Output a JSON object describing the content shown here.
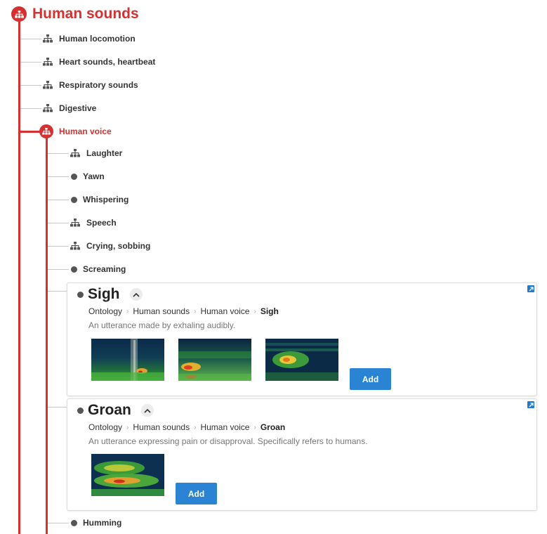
{
  "root": {
    "title": "Human sounds"
  },
  "level1": [
    {
      "label": "Human locomotion",
      "icon": "tree-icon"
    },
    {
      "label": "Heart sounds, heartbeat",
      "icon": "tree-icon"
    },
    {
      "label": "Respiratory sounds",
      "icon": "tree-icon"
    },
    {
      "label": "Digestive",
      "icon": "tree-icon"
    }
  ],
  "active": {
    "label": "Human voice",
    "icon": "tree-icon"
  },
  "level2": [
    {
      "label": "Laughter",
      "icon": "tree-icon"
    },
    {
      "label": "Yawn",
      "icon": "dot-icon"
    },
    {
      "label": "Whispering",
      "icon": "dot-icon"
    },
    {
      "label": "Speech",
      "icon": "tree-icon"
    },
    {
      "label": "Crying, sobbing",
      "icon": "tree-icon"
    },
    {
      "label": "Screaming",
      "icon": "dot-icon"
    }
  ],
  "cards": [
    {
      "title": "Sigh",
      "breadcrumb": [
        "Ontology",
        "Human sounds",
        "Human voice",
        "Sigh"
      ],
      "description": "An utterance made by exhaling audibly.",
      "add_label": "Add"
    },
    {
      "title": "Groan",
      "breadcrumb": [
        "Ontology",
        "Human sounds",
        "Human voice",
        "Groan"
      ],
      "description": "An utterance expressing pain or disapproval. Specifically refers to humans.",
      "add_label": "Add"
    }
  ],
  "last": {
    "label": "Humming",
    "icon": "dot-icon"
  },
  "colors": {
    "accent": "#d63031",
    "button": "#2b84d3"
  }
}
